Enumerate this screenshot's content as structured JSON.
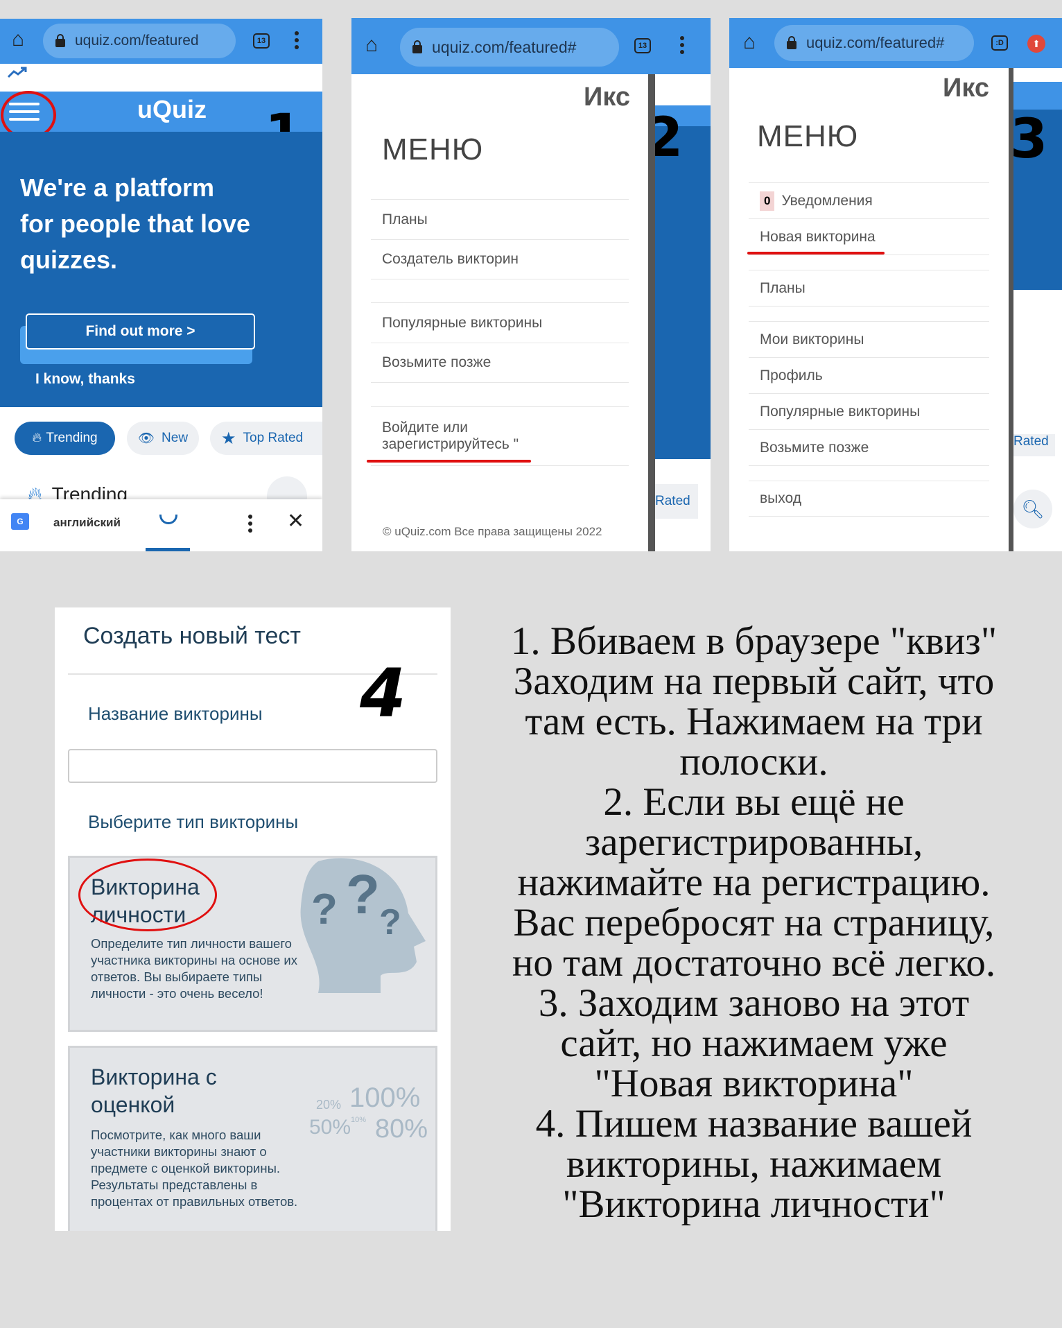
{
  "panel1": {
    "step_number": "1",
    "url": "uquiz.com/featured",
    "tab_count": "13",
    "logo": "uQuiz",
    "hero_lines": [
      "We're a platform",
      "for people that love",
      "quizzes."
    ],
    "find_out_more": "Find out more >",
    "dismiss": "I know, thanks",
    "tabs": [
      {
        "label": "Trending",
        "icon": "flame-icon"
      },
      {
        "label": "New",
        "icon": "eye-icon"
      },
      {
        "label": "Top Rated",
        "icon": "star-icon"
      }
    ],
    "section_title": "Trending",
    "translate_bar": {
      "language": "английский"
    },
    "colors": {
      "brand_blue": "#1a66b0",
      "header_blue": "#3f93e6",
      "annotation_red": "#e01010"
    }
  },
  "panel2": {
    "step_number": "2",
    "url": "uquiz.com/featured#",
    "tab_count": "13",
    "close_label": "Икс",
    "menu_title": "МЕНЮ",
    "items": [
      "Планы",
      "Создатель викторин",
      "Популярные викторины",
      "Возьмите позже",
      "Войдите или",
      "зарегистрируйтесь \""
    ],
    "footer": "© uQuiz.com Все права защищены 2022",
    "behind_tab": "Rated"
  },
  "panel3": {
    "step_number": "3",
    "url": "uquiz.com/featured#",
    "tab_count": ":D",
    "close_label": "Икс",
    "menu_title": "МЕНЮ",
    "notification_count": "0",
    "items": [
      "Уведомления",
      "Новая викторина",
      "Планы",
      "Мои викторины",
      "Профиль",
      "Популярные викторины",
      "Возьмите позже",
      "выход"
    ],
    "behind_tab": "Rated"
  },
  "panel4": {
    "step_number": "4",
    "title": "Создать новый тест",
    "name_label": "Название викторины",
    "name_value": "",
    "type_label": "Выберите тип викторины",
    "cards": [
      {
        "title_lines": [
          "Викторина",
          "личности"
        ],
        "description": "Определите тип личности вашего участника викторины на основе их ответов. Вы выбираете типы личности - это очень весело!"
      },
      {
        "title_lines": [
          "Викторина с",
          "оценкой"
        ],
        "description": "Посмотрите, как много ваши участники викторины знают о предмете с оценкой викторины. Результаты представлены в процентах от правильных ответов.",
        "illustration_labels": [
          "20%",
          "100%",
          "50%",
          "10%",
          "80%"
        ]
      }
    ]
  },
  "instructions": [
    "1. Вбиваем в браузере \"квиз\"",
    "Заходим на первый сайт, что",
    "там есть. Нажимаем на три",
    "полоски.",
    "2. Если вы ещё не",
    "зарегистрированны,",
    "нажимайте на регистрацию.",
    "Вас перебросят на страницу,",
    "но там достаточно всё легко.",
    "3. Заходим заново на этот",
    "сайт, но нажимаем уже",
    "\"Новая викторина\"",
    "4. Пишем название вашей",
    "викторины, нажимаем",
    "\"Викторина личности\""
  ]
}
